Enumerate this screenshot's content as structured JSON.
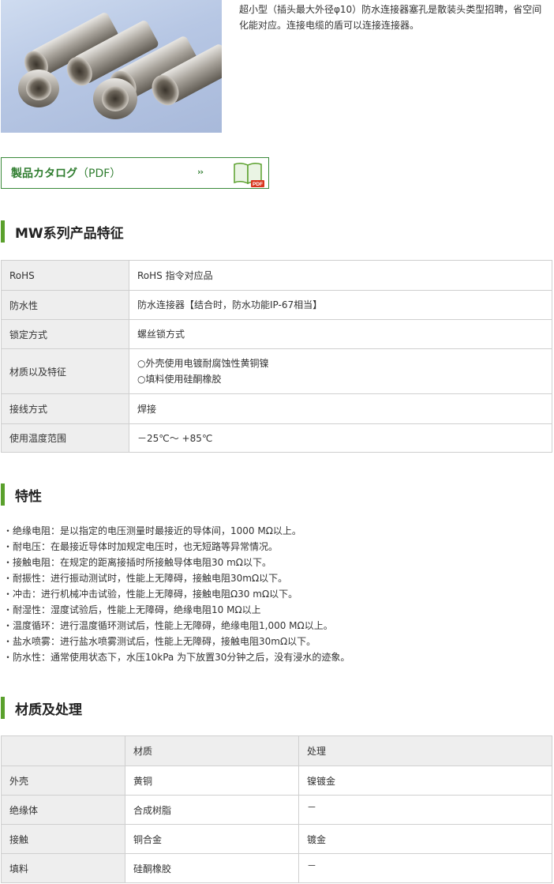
{
  "intro": "超小型（插头最大外径φ10）防水连接器塞孔是散装头类型招聘，省空间化能对应。连接电缆的盾可以连接连接器。",
  "catalog": {
    "label_bold": "製品カタログ",
    "label_rest": "（PDF）",
    "arrow": "››",
    "icon_text": "PDF"
  },
  "section1": {
    "title": "MW系列产品特征",
    "rows": [
      {
        "key": "RoHS",
        "value": "RoHS 指令对应品"
      },
      {
        "key": "防水性",
        "value": "防水连接器【结合时，防水功能IP-67相当】"
      },
      {
        "key": "锁定方式",
        "value": "螺丝锁方式"
      },
      {
        "key": "材质以及特征",
        "value": "○外壳使用电镀耐腐蚀性黄铜镍",
        "value2": "○填料使用硅酮橡胶"
      },
      {
        "key": "接线方式",
        "value": "焊接"
      },
      {
        "key": "使用温度范围",
        "value": "－25℃～ +85℃"
      }
    ]
  },
  "section2": {
    "title": "特性",
    "items": [
      "・绝缘电阻：是以指定的电压测量时最接近的导体间，1000 MΩ以上。",
      "・耐电压：在最接近导体时加规定电压时，也无短路等异常情况。",
      "・接触电阻：在规定的距离接插时所接触导体电阻30 mΩ以下。",
      "・耐振性：进行振动测试时，性能上无障碍，接触电阻30mΩ以下。",
      "・冲击：进行机械冲击试验，性能上无障碍，接触电阻Ω30 mΩ以下。",
      "・耐湿性：湿度试验后，性能上无障碍，绝缘电阻10 MΩ以上",
      "・温度循环：进行温度循环测试后，性能上无障碍，绝缘电阻1,000 MΩ以上。",
      "・盐水喷雾：进行盐水喷雾测试后，性能上无障碍，接触电阻30mΩ以下。",
      "・防水性：通常使用状态下，水压10kPa 为下放置30分钟之后，没有浸水的迹象。"
    ]
  },
  "section3": {
    "title": "材质及处理",
    "headers": [
      "",
      "材质",
      "处理"
    ],
    "rows": [
      [
        "外壳",
        "黄铜",
        "镍镀金"
      ],
      [
        "绝缘体",
        "合成树脂",
        "－"
      ],
      [
        "接触",
        "铜合金",
        "镀金"
      ],
      [
        "填料",
        "硅酮橡胶",
        "－"
      ]
    ]
  },
  "colors": {
    "accent_green": "#5aa02c",
    "catalog_green": "#2f7d2f",
    "table_header_bg": "#eeeeee"
  }
}
